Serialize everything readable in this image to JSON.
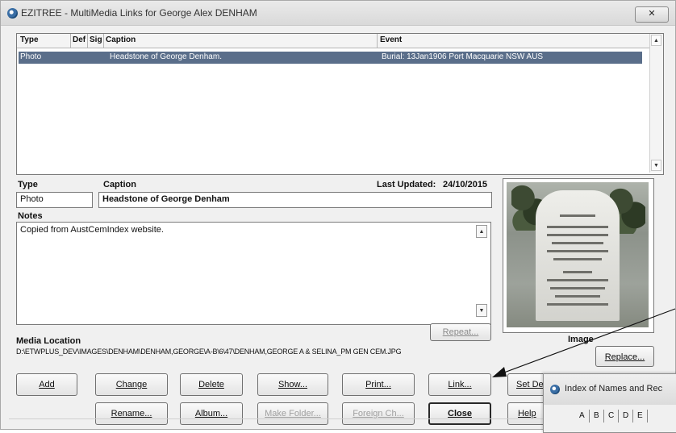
{
  "window": {
    "title": "EZITREE - MultiMedia Links for George Alex DENHAM",
    "close_label": "✕"
  },
  "grid": {
    "headers": {
      "type": "Type",
      "def": "Def",
      "sig": "Sig",
      "caption": "Caption",
      "event": "Event"
    },
    "rows": [
      {
        "type": "Photo",
        "caption": "Headstone of George Denham.",
        "event": "Burial: 13Jan1906 Port Macquarie NSW AUS"
      }
    ]
  },
  "detail": {
    "type_label": "Type",
    "type_value": "Photo",
    "caption_label": "Caption",
    "caption_value": "Headstone of George Denham",
    "last_updated_label": "Last Updated:",
    "last_updated_value": "24/10/2015",
    "notes_label": "Notes",
    "notes_value": "Copied from AustCemIndex website.",
    "image_label": "Image",
    "media_location_label": "Media Location",
    "media_location_value": "D:\\ETWPLUS_DEV\\IMAGES\\DENHAM\\DENHAM,GEORGE\\A-B\\6\\47\\DENHAM,GEORGE A & SELINA_PM GEN CEM.JPG"
  },
  "buttons": {
    "repeat": "Repeat...",
    "replace": "Replace...",
    "add": "Add",
    "change": "Change",
    "delete": "Delete",
    "show": "Show...",
    "print": "Print...",
    "link": "Link...",
    "set_default": "Set De",
    "rename": "Rename...",
    "album": "Album...",
    "make_folder": "Make Folder...",
    "foreign_ch": "Foreign Ch...",
    "close": "Close",
    "help": "Help"
  },
  "sub_window": {
    "title": "Index of Names and Rec",
    "letters": [
      "A",
      "B",
      "C",
      "D",
      "E"
    ]
  }
}
